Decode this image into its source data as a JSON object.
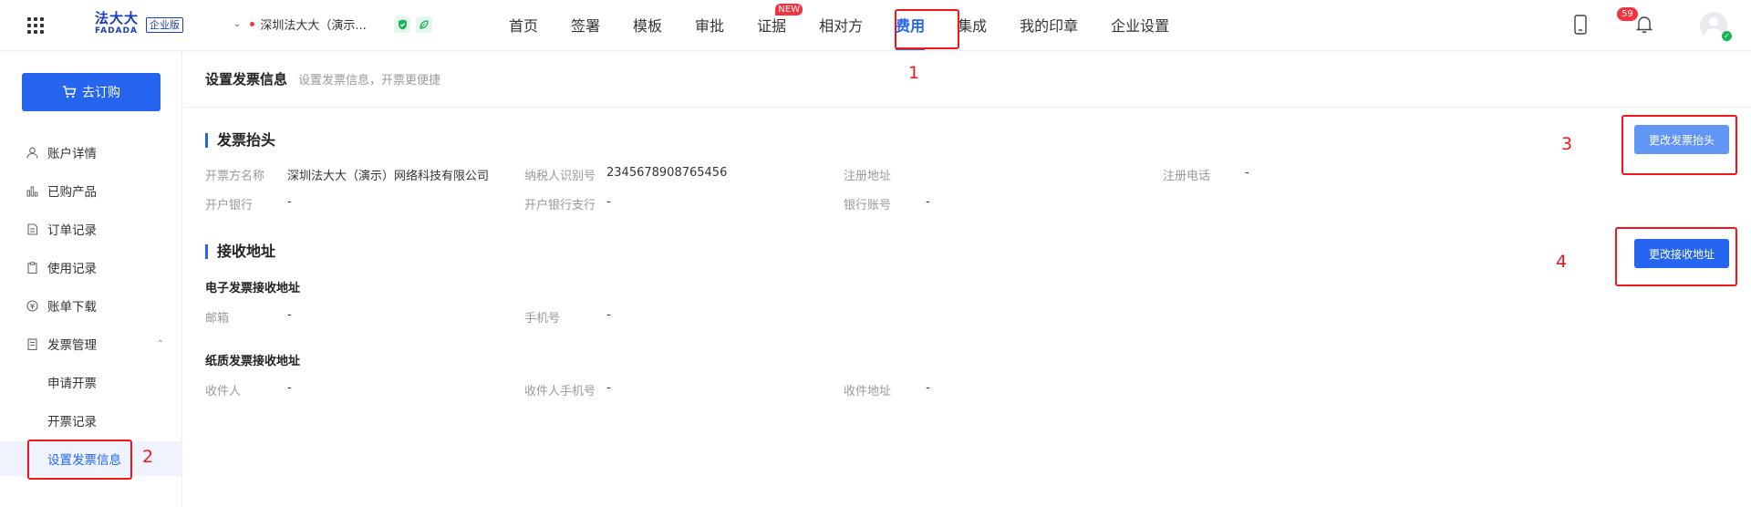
{
  "header": {
    "logo_cn": "法大大",
    "logo_en": "FADADA",
    "edition": "企业版",
    "company": "深圳法大大（演示...",
    "nav": [
      {
        "label": "首页",
        "active": false
      },
      {
        "label": "签署",
        "active": false
      },
      {
        "label": "模板",
        "active": false
      },
      {
        "label": "审批",
        "active": false
      },
      {
        "label": "证据",
        "active": false,
        "tag": "NEW"
      },
      {
        "label": "相对方",
        "active": false
      },
      {
        "label": "费用",
        "active": true
      },
      {
        "label": "集成",
        "active": false
      },
      {
        "label": "我的印章",
        "active": false
      },
      {
        "label": "企业设置",
        "active": false
      }
    ],
    "notification_count": "59"
  },
  "sidebar": {
    "buy_label": "去订购",
    "items": [
      {
        "label": "账户详情",
        "icon": "user-icon"
      },
      {
        "label": "已购产品",
        "icon": "bar-chart-icon"
      },
      {
        "label": "订单记录",
        "icon": "order-icon"
      },
      {
        "label": "使用记录",
        "icon": "clipboard-icon"
      },
      {
        "label": "账单下载",
        "icon": "bill-icon"
      },
      {
        "label": "发票管理",
        "icon": "invoice-icon"
      },
      {
        "label": "申请开票"
      },
      {
        "label": "开票记录"
      },
      {
        "label": "设置发票信息",
        "active": true
      }
    ]
  },
  "page": {
    "title": "设置发票信息",
    "subtitle": "设置发票信息，开票更便捷"
  },
  "invoice_header": {
    "title": "发票抬头",
    "button": "更改发票抬头",
    "fields": [
      {
        "key": "开票方名称",
        "value": "深圳法大大（演示）网络科技有限公司"
      },
      {
        "key": "纳税人识别号",
        "value": "2345678908765456"
      },
      {
        "key": "注册地址",
        "value": ""
      },
      {
        "key": "注册电话",
        "value": "-"
      },
      {
        "key": "开户银行",
        "value": "-"
      },
      {
        "key": "开户银行支行",
        "value": "-"
      },
      {
        "key": "银行账号",
        "value": "-"
      }
    ]
  },
  "address": {
    "title": "接收地址",
    "button": "更改接收地址",
    "electronic": {
      "title": "电子发票接收地址",
      "fields": [
        {
          "key": "邮箱",
          "value": "-"
        },
        {
          "key": "手机号",
          "value": "-"
        }
      ]
    },
    "paper": {
      "title": "纸质发票接收地址",
      "fields": [
        {
          "key": "收件人",
          "value": "-"
        },
        {
          "key": "收件人手机号",
          "value": "-"
        },
        {
          "key": "收件地址",
          "value": "-"
        }
      ]
    }
  },
  "annotations": [
    "1",
    "2",
    "3",
    "4"
  ],
  "colors": {
    "primary": "#2565f0",
    "primary_light": "#6196f5",
    "annotation_red": "#f2161c"
  }
}
